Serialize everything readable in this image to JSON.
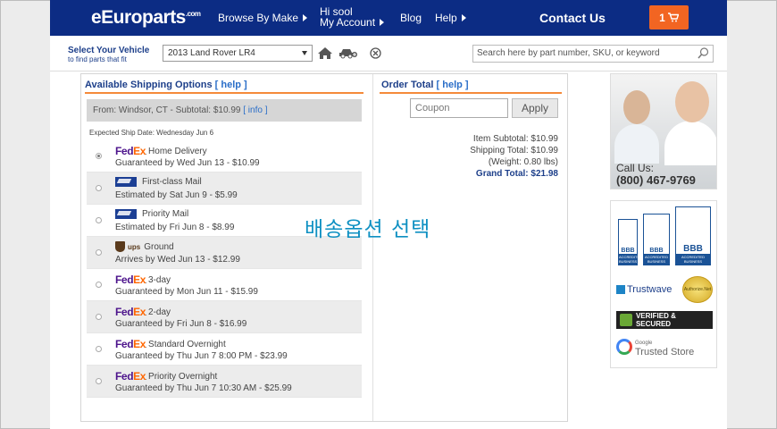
{
  "header": {
    "logo": "eEuroparts",
    "logo_suffix": ".com",
    "browse": "Browse By Make",
    "account_greeting": "Hi sool",
    "account": "My Account",
    "blog": "Blog",
    "help": "Help",
    "contact": "Contact Us",
    "cart_count": "1"
  },
  "vehicle": {
    "label": "Select Your Vehicle",
    "sublabel": "to find parts that fit",
    "selected": "2013 Land Rover LR4",
    "search_placeholder": "Search here by part number, SKU, or keyword"
  },
  "shipping": {
    "title": "Available Shipping Options",
    "help": "[ help ]",
    "from": "From: Windsor, CT - Subtotal: $10.99",
    "info": "[ info ]",
    "ship_date": "Expected Ship Date: Wednesday Jun 6",
    "options": [
      {
        "carrier": "FedEx",
        "service": "Home Delivery",
        "estimate": "Guaranteed by Wed Jun 13 - $10.99",
        "selected": true
      },
      {
        "carrier": "USPS",
        "service": "First-class Mail",
        "estimate": "Estimated by Sat Jun 9 - $5.99",
        "selected": false
      },
      {
        "carrier": "USPS",
        "service": "Priority Mail",
        "estimate": "Estimated by Fri Jun 8 - $8.99",
        "selected": false
      },
      {
        "carrier": "UPS",
        "service": "Ground",
        "estimate": "Arrives by Wed Jun 13 - $12.99",
        "selected": false
      },
      {
        "carrier": "FedEx",
        "service": "3-day",
        "estimate": "Guaranteed by Mon Jun 11 - $15.99",
        "selected": false
      },
      {
        "carrier": "FedEx",
        "service": "2-day",
        "estimate": "Guaranteed by Fri Jun 8 - $16.99",
        "selected": false
      },
      {
        "carrier": "FedEx",
        "service": "Standard Overnight",
        "estimate": "Guaranteed by Thu Jun 7 8:00 PM - $23.99",
        "selected": false
      },
      {
        "carrier": "FedEx",
        "service": "Priority Overnight",
        "estimate": "Guaranteed by Thu Jun 7 10:30 AM - $25.99",
        "selected": false
      }
    ],
    "annotation": "배송옵션 선택"
  },
  "order": {
    "title": "Order Total",
    "help": "[ help ]",
    "coupon_placeholder": "Coupon",
    "apply": "Apply",
    "item_subtotal": "Item Subtotal: $10.99",
    "shipping_total": "Shipping Total: $10.99",
    "weight": "(Weight: 0.80 lbs)",
    "grand_total": "Grand Total: $21.98"
  },
  "sidebar": {
    "call_label": "Call Us:",
    "phone": "(800) 467-9769",
    "bbb_top": "BBB",
    "bbb_sub": "ACCREDITED BUSINESS",
    "trustwave": "Trustwave",
    "seal": "Authorize.Net",
    "verified": "VERIFIED & SECURED",
    "gts_small": "Google",
    "gts": "Trusted Store"
  },
  "colors": {
    "header_bg": "#0c2c84",
    "cart_btn": "#f26522",
    "accent_line": "#f58a3a",
    "link_blue": "#2a6ec8",
    "annotation": "#0e90c2"
  }
}
